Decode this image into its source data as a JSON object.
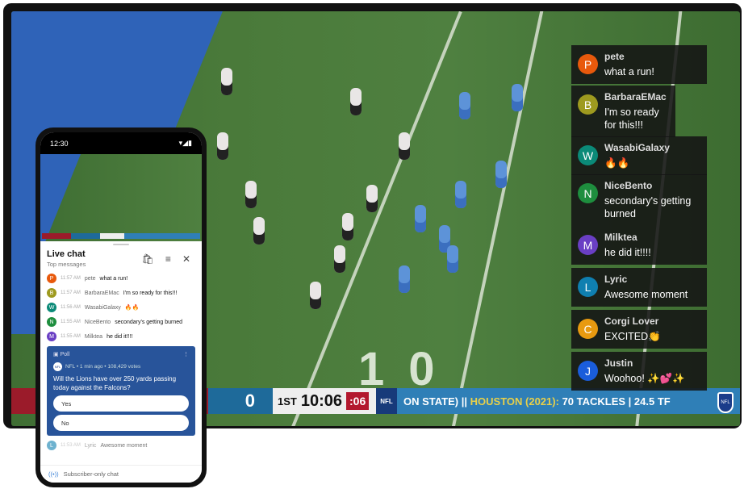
{
  "tv": {
    "yard_number": "10",
    "scorebar": {
      "home_score": "0",
      "quarter": "1ST",
      "clock": "10:06",
      "play_clock": ":06",
      "logo": "NFL",
      "ticker_a": "ON STATE) ||",
      "ticker_b": "HOUSTON (2021):",
      "ticker_c": "70 TACKLES | 24.5 TF"
    },
    "watermark": "NFL",
    "chat": [
      {
        "initial": "P",
        "name": "pete",
        "text": "what a run!",
        "color": "#e8590c"
      },
      {
        "initial": "B",
        "name": "BarbaraEMac",
        "text": "I'm so ready for this!!!",
        "color": "#9e9a1f"
      },
      {
        "initial": "W",
        "name": "WasabiGalaxy",
        "text": "🔥🔥",
        "color": "#0b8a78"
      },
      {
        "initial": "N",
        "name": "NiceBento",
        "text": "secondary's getting burned",
        "color": "#1e8e3e"
      },
      {
        "initial": "M",
        "name": "Milktea",
        "text": "he did it!!!!",
        "color": "#6a3fc4"
      },
      {
        "initial": "L",
        "name": "Lyric",
        "text": "Awesome moment",
        "color": "#0f7fb0"
      },
      {
        "initial": "C",
        "name": "Corgi Lover",
        "text": "EXCITED👏",
        "color": "#e89a10"
      },
      {
        "initial": "J",
        "name": "Justin",
        "text": "Woohoo! ✨💕✨",
        "color": "#1a5ddb"
      }
    ]
  },
  "phone": {
    "time": "12:30",
    "status_icons": "▾◢▮",
    "chat": {
      "title": "Live chat",
      "subtitle": "Top messages",
      "icons": [
        "shopping-bag-icon",
        "filter-icon",
        "close-icon"
      ],
      "messages": [
        {
          "initial": "P",
          "time": "11:57 AM",
          "name": "pete",
          "text": "what a run!",
          "color": "#e8590c"
        },
        {
          "initial": "B",
          "time": "11:57 AM",
          "name": "BarbaraEMac",
          "text": "I'm so ready for this!!!",
          "color": "#9e9a1f"
        },
        {
          "initial": "W",
          "time": "11:56 AM",
          "name": "WasabiGalaxy",
          "text": "🔥🔥",
          "color": "#0b8a78"
        },
        {
          "initial": "N",
          "time": "11:55 AM",
          "name": "NiceBento",
          "text": "secondary's getting burned",
          "color": "#1e8e3e"
        },
        {
          "initial": "M",
          "time": "11:55 AM",
          "name": "Milktea",
          "text": "he did it!!!!",
          "color": "#6a3fc4"
        }
      ],
      "poll": {
        "label": "Poll",
        "meta": "NFL • 1 min ago • 108,429 votes",
        "question": "Will the Lions have over 250 yards passing today against the Falcons?",
        "options": [
          "Yes",
          "No"
        ]
      },
      "partial_message": {
        "initial": "L",
        "time": "11:53 AM",
        "name": "Lyric",
        "text": "Awesome moment",
        "color": "#0f7fb0"
      },
      "footer": "Subscriber-only chat"
    }
  }
}
